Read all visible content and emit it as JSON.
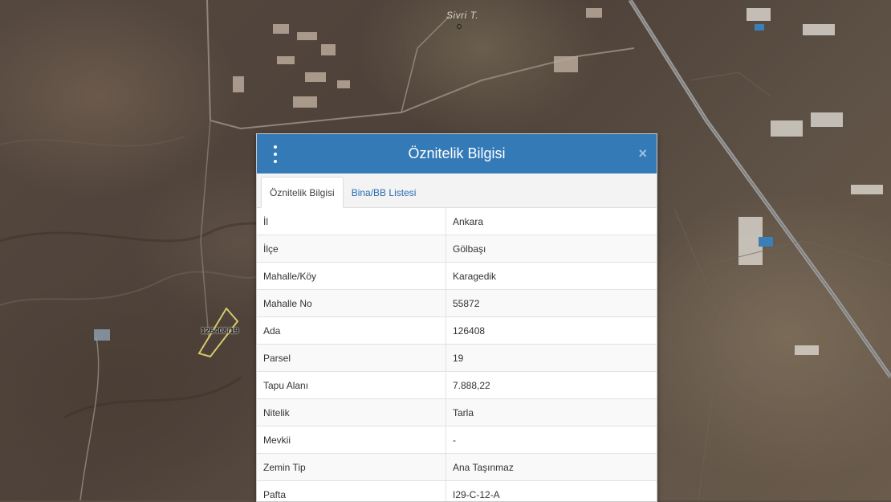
{
  "map": {
    "peak_label": "Sivri T.",
    "parcel_label": "126408/19"
  },
  "dialog": {
    "title": "Öznitelik Bilgisi",
    "menu_icon": "vertical-ellipsis-icon",
    "close_icon": "close-icon",
    "close_label": "×",
    "tabs": [
      {
        "label": "Öznitelik Bilgisi",
        "active": true
      },
      {
        "label": "Bina/BB Listesi",
        "active": false
      }
    ],
    "rows": [
      {
        "key": "İl",
        "value": "Ankara"
      },
      {
        "key": "İlçe",
        "value": "Gölbaşı"
      },
      {
        "key": "Mahalle/Köy",
        "value": "Karagedik"
      },
      {
        "key": "Mahalle No",
        "value": "55872"
      },
      {
        "key": "Ada",
        "value": "126408"
      },
      {
        "key": "Parsel",
        "value": "19"
      },
      {
        "key": "Tapu Alanı",
        "value": "7.888,22"
      },
      {
        "key": "Nitelik",
        "value": "Tarla"
      },
      {
        "key": "Mevkii",
        "value": "-"
      },
      {
        "key": "Zemin Tip",
        "value": "Ana Taşınmaz"
      },
      {
        "key": "Pafta",
        "value": "I29-C-12-A"
      }
    ]
  },
  "colors": {
    "header": "#337ab7",
    "tab_link": "#2a6cb0",
    "parcel_outline": "#d6c96a"
  }
}
